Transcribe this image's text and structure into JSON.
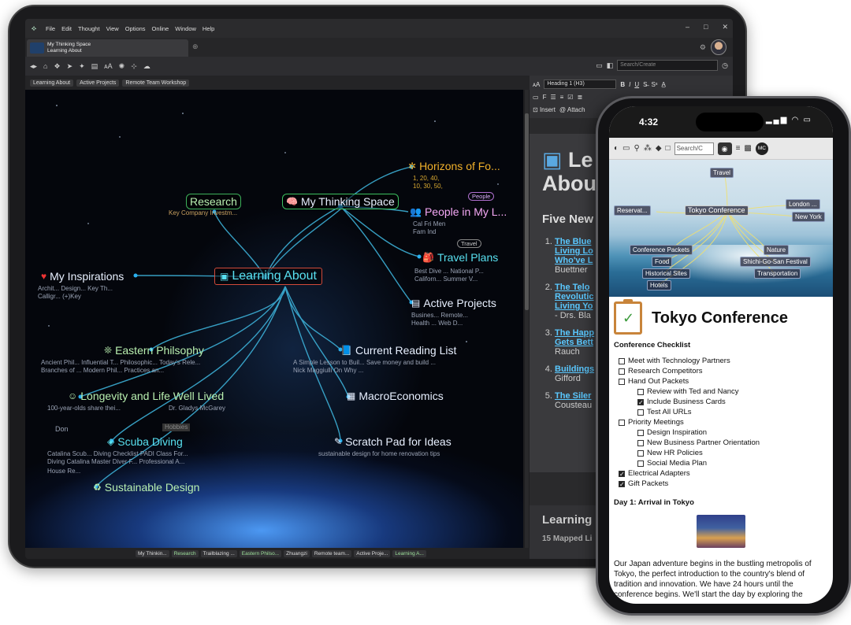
{
  "tablet": {
    "menu": [
      "File",
      "Edit",
      "Thought",
      "View",
      "Options",
      "Online",
      "Window",
      "Help"
    ],
    "tab": {
      "line1": "My Thinking Space",
      "line2": "Learning About"
    },
    "search_placeholder": "Search/Create",
    "breadcrumbs": [
      "Learning About",
      "Active Projects",
      "Remote Team Workshop"
    ],
    "nodes": {
      "horizons": "Horizons of Fo...",
      "research": "Research",
      "research_sub": "Key Company Investm...",
      "thinking": "My Thinking Space",
      "people_tag": "People",
      "people": "People in My L...",
      "travel_tag": "Travel",
      "travel": "Travel Plans",
      "inspirations": "My Inspirations",
      "insp_sub1": "Archit...   Design...   Key Th...",
      "insp_sub2": "Calligr...   (+)Key",
      "learning": "Learning About",
      "active": "Active Projects",
      "active_sub1": "Busines...   Remote...",
      "active_sub2": "Health ...   Web D...",
      "travel_sub1": "Best Dive ...   National P...",
      "travel_sub2": "Californ...   Summer V...",
      "people_sub1": "Cal   Fri   Men",
      "people_sub2": "Fam   Ind",
      "horizons_sub1": "1,   20,   40,",
      "horizons_sub2": "10,   30,   50,",
      "eastern": "Eastern Philsophy",
      "east_sub1": "Ancient Phil...   Influential T...   Philosophic...   Today's Rele...",
      "east_sub2": "Branches of ...   Modern Phil...   Practices an...",
      "reading": "Current Reading List",
      "reading_sub1": "A Simple Lesson to Buil...   Save money and build ...",
      "reading_sub2": "Nick Maggiulli On Why ...",
      "longevity": "Longevity and Life Well Lived",
      "long_sub1": "100-year-olds share thei...",
      "long_sub2": "Dr. Gladys McGarey",
      "macro": "MacroEconomics",
      "don": "Don",
      "hobbies": "Hobbies",
      "scuba": "Scuba Diving",
      "scuba_sub1": "Catalina Scub...   Diving Checklist   PADI Class For...",
      "scuba_sub2": "Diving Catalina   Master Diver F...   Professional A...",
      "scuba_sub3": "House Re...",
      "scratch": "Scratch Pad for Ideas",
      "scratch_sub": "sustainable design for home renovation tips",
      "sustainable": "Sustainable Design"
    },
    "bottom_tabs": [
      "My Thinkin...",
      "Research",
      "Trailblazing ...",
      "Eastern Philso...",
      "Zhuangzi",
      "Remote team...",
      "Active Proje...",
      "Learning A..."
    ],
    "notes": {
      "heading_select": "Heading 1 (H3)",
      "insert": "Insert",
      "attach": "Attach",
      "title": "Le... Abou...",
      "title1": "Le",
      "title2": "Abou",
      "subhead": "Five New",
      "items": [
        {
          "link1": "The Blue",
          "link2": "Living Lo",
          "link3": "Who've L",
          "author": "Buettner"
        },
        {
          "link1": "The Telo",
          "link2": "Revolutic",
          "link3": "Living Yo",
          "author": "- Drs. Bla"
        },
        {
          "link1": "The Happ",
          "link2": "Gets Bett",
          "link3": "",
          "author": "Rauch"
        },
        {
          "link1": "Buildings",
          "link2": "",
          "link3": "",
          "author": "Gifford"
        },
        {
          "link1": "The Siler",
          "link2": "",
          "link3": "",
          "author": "Cousteau"
        }
      ],
      "footer_title": "Learning",
      "footer_sub": "15 Mapped Li"
    }
  },
  "phone": {
    "time": "4:32",
    "search": "Search/C",
    "avatar": "MC",
    "brain_nodes": {
      "travel": "Travel",
      "reservations": "Reservat...",
      "tokyo": "Tokyo Conference",
      "london": "London ...",
      "newyork": "New York",
      "packets": "Conference Packets",
      "nature": "Nature",
      "food": "Food",
      "festival": "Shichi-Go-San Festival",
      "historical": "Historical Sites",
      "transport": "Transportation",
      "hotels": "Hotels"
    },
    "note_title": "Tokyo Conference",
    "checklist_title": "Conference Checklist",
    "checklist": [
      {
        "text": "Meet with Technology Partners",
        "level": 1,
        "checked": false
      },
      {
        "text": "Research Competitors",
        "level": 1,
        "checked": false
      },
      {
        "text": "Hand Out Packets",
        "level": 1,
        "checked": false
      },
      {
        "text": "Review with Ted and Nancy",
        "level": 2,
        "checked": false
      },
      {
        "text": "Include Business Cards",
        "level": 2,
        "checked": true
      },
      {
        "text": "Test All URLs",
        "level": 2,
        "checked": false
      },
      {
        "text": "Priority Meetings",
        "level": 1,
        "checked": false
      },
      {
        "text": "Design Inspiration",
        "level": 2,
        "checked": false
      },
      {
        "text": "New Business Partner Orientation",
        "level": 2,
        "checked": false
      },
      {
        "text": "New HR Policies",
        "level": 2,
        "checked": false
      },
      {
        "text": "Social Media Plan",
        "level": 2,
        "checked": false
      },
      {
        "text": "Electrical Adapters",
        "level": 1,
        "checked": true
      },
      {
        "text": "Gift Packets",
        "level": 1,
        "checked": true
      }
    ],
    "day_title": "Day 1: Arrival in Tokyo",
    "paragraph": "Our Japan adventure begins in the bustling metropolis of Tokyo, the perfect introduction to the country's blend of tradition and innovation. We have 24 hours until the conference begins. We'll start the day by exploring the"
  }
}
